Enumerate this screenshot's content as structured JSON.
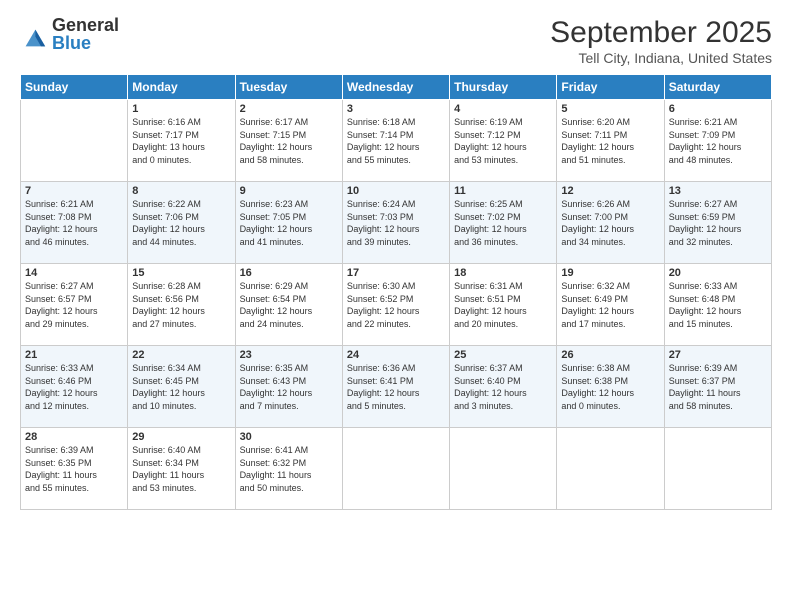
{
  "header": {
    "logo_line1": "General",
    "logo_line2": "Blue",
    "month": "September 2025",
    "location": "Tell City, Indiana, United States"
  },
  "weekdays": [
    "Sunday",
    "Monday",
    "Tuesday",
    "Wednesday",
    "Thursday",
    "Friday",
    "Saturday"
  ],
  "weeks": [
    [
      {
        "day": "",
        "info": ""
      },
      {
        "day": "1",
        "info": "Sunrise: 6:16 AM\nSunset: 7:17 PM\nDaylight: 13 hours\nand 0 minutes."
      },
      {
        "day": "2",
        "info": "Sunrise: 6:17 AM\nSunset: 7:15 PM\nDaylight: 12 hours\nand 58 minutes."
      },
      {
        "day": "3",
        "info": "Sunrise: 6:18 AM\nSunset: 7:14 PM\nDaylight: 12 hours\nand 55 minutes."
      },
      {
        "day": "4",
        "info": "Sunrise: 6:19 AM\nSunset: 7:12 PM\nDaylight: 12 hours\nand 53 minutes."
      },
      {
        "day": "5",
        "info": "Sunrise: 6:20 AM\nSunset: 7:11 PM\nDaylight: 12 hours\nand 51 minutes."
      },
      {
        "day": "6",
        "info": "Sunrise: 6:21 AM\nSunset: 7:09 PM\nDaylight: 12 hours\nand 48 minutes."
      }
    ],
    [
      {
        "day": "7",
        "info": "Sunrise: 6:21 AM\nSunset: 7:08 PM\nDaylight: 12 hours\nand 46 minutes."
      },
      {
        "day": "8",
        "info": "Sunrise: 6:22 AM\nSunset: 7:06 PM\nDaylight: 12 hours\nand 44 minutes."
      },
      {
        "day": "9",
        "info": "Sunrise: 6:23 AM\nSunset: 7:05 PM\nDaylight: 12 hours\nand 41 minutes."
      },
      {
        "day": "10",
        "info": "Sunrise: 6:24 AM\nSunset: 7:03 PM\nDaylight: 12 hours\nand 39 minutes."
      },
      {
        "day": "11",
        "info": "Sunrise: 6:25 AM\nSunset: 7:02 PM\nDaylight: 12 hours\nand 36 minutes."
      },
      {
        "day": "12",
        "info": "Sunrise: 6:26 AM\nSunset: 7:00 PM\nDaylight: 12 hours\nand 34 minutes."
      },
      {
        "day": "13",
        "info": "Sunrise: 6:27 AM\nSunset: 6:59 PM\nDaylight: 12 hours\nand 32 minutes."
      }
    ],
    [
      {
        "day": "14",
        "info": "Sunrise: 6:27 AM\nSunset: 6:57 PM\nDaylight: 12 hours\nand 29 minutes."
      },
      {
        "day": "15",
        "info": "Sunrise: 6:28 AM\nSunset: 6:56 PM\nDaylight: 12 hours\nand 27 minutes."
      },
      {
        "day": "16",
        "info": "Sunrise: 6:29 AM\nSunset: 6:54 PM\nDaylight: 12 hours\nand 24 minutes."
      },
      {
        "day": "17",
        "info": "Sunrise: 6:30 AM\nSunset: 6:52 PM\nDaylight: 12 hours\nand 22 minutes."
      },
      {
        "day": "18",
        "info": "Sunrise: 6:31 AM\nSunset: 6:51 PM\nDaylight: 12 hours\nand 20 minutes."
      },
      {
        "day": "19",
        "info": "Sunrise: 6:32 AM\nSunset: 6:49 PM\nDaylight: 12 hours\nand 17 minutes."
      },
      {
        "day": "20",
        "info": "Sunrise: 6:33 AM\nSunset: 6:48 PM\nDaylight: 12 hours\nand 15 minutes."
      }
    ],
    [
      {
        "day": "21",
        "info": "Sunrise: 6:33 AM\nSunset: 6:46 PM\nDaylight: 12 hours\nand 12 minutes."
      },
      {
        "day": "22",
        "info": "Sunrise: 6:34 AM\nSunset: 6:45 PM\nDaylight: 12 hours\nand 10 minutes."
      },
      {
        "day": "23",
        "info": "Sunrise: 6:35 AM\nSunset: 6:43 PM\nDaylight: 12 hours\nand 7 minutes."
      },
      {
        "day": "24",
        "info": "Sunrise: 6:36 AM\nSunset: 6:41 PM\nDaylight: 12 hours\nand 5 minutes."
      },
      {
        "day": "25",
        "info": "Sunrise: 6:37 AM\nSunset: 6:40 PM\nDaylight: 12 hours\nand 3 minutes."
      },
      {
        "day": "26",
        "info": "Sunrise: 6:38 AM\nSunset: 6:38 PM\nDaylight: 12 hours\nand 0 minutes."
      },
      {
        "day": "27",
        "info": "Sunrise: 6:39 AM\nSunset: 6:37 PM\nDaylight: 11 hours\nand 58 minutes."
      }
    ],
    [
      {
        "day": "28",
        "info": "Sunrise: 6:39 AM\nSunset: 6:35 PM\nDaylight: 11 hours\nand 55 minutes."
      },
      {
        "day": "29",
        "info": "Sunrise: 6:40 AM\nSunset: 6:34 PM\nDaylight: 11 hours\nand 53 minutes."
      },
      {
        "day": "30",
        "info": "Sunrise: 6:41 AM\nSunset: 6:32 PM\nDaylight: 11 hours\nand 50 minutes."
      },
      {
        "day": "",
        "info": ""
      },
      {
        "day": "",
        "info": ""
      },
      {
        "day": "",
        "info": ""
      },
      {
        "day": "",
        "info": ""
      }
    ]
  ]
}
